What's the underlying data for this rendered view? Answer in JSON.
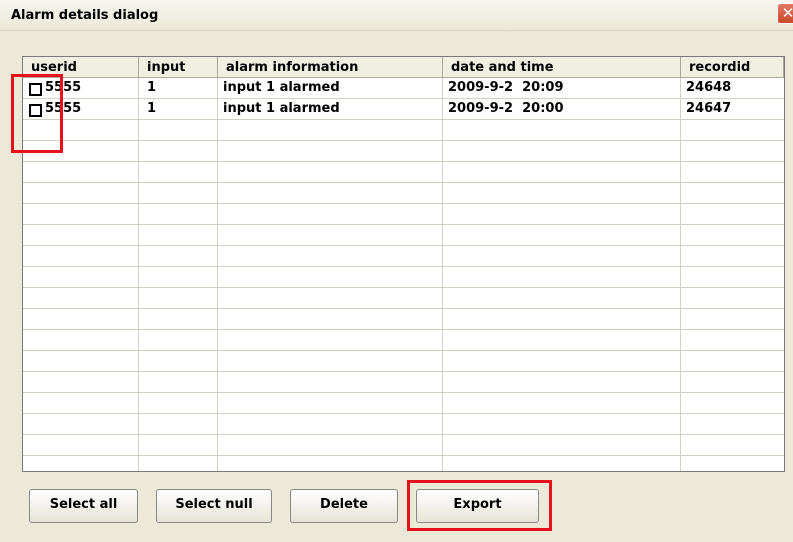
{
  "window": {
    "title": "Alarm details dialog",
    "close_label": "✕"
  },
  "table": {
    "columns": [
      "userid",
      "input",
      "alarm information",
      "date and time",
      "recordid"
    ],
    "rows": [
      {
        "userid": "5555",
        "input": "1",
        "alarm_information": "input 1 alarmed",
        "date_and_time": "2009-9-2  20:09",
        "recordid": "24648",
        "checked": false
      },
      {
        "userid": "5555",
        "input": "1",
        "alarm_information": "input 1 alarmed",
        "date_and_time": "2009-9-2  20:00",
        "recordid": "24647",
        "checked": false
      }
    ]
  },
  "buttons": {
    "select_all": "Select all",
    "select_null": "Select null",
    "delete": "Delete",
    "export": "Export"
  },
  "colors": {
    "highlight": "#e8101c",
    "dialog_background": "#ece9d8"
  }
}
